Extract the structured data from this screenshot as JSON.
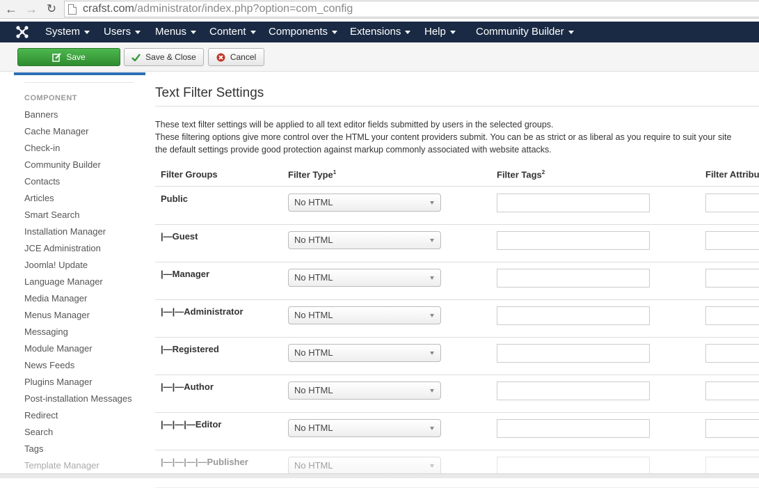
{
  "browser": {
    "url_host": "crafst.com",
    "url_path": "/administrator/index.php?option=com_config"
  },
  "topnav": {
    "logo": "joomla-icon",
    "items": [
      {
        "label": "System"
      },
      {
        "label": "Users"
      },
      {
        "label": "Menus"
      },
      {
        "label": "Content"
      },
      {
        "label": "Components"
      },
      {
        "label": "Extensions"
      },
      {
        "label": "Help"
      },
      {
        "label": "Community Builder"
      }
    ]
  },
  "toolbar": {
    "save": "Save",
    "save_close": "Save & Close",
    "cancel": "Cancel"
  },
  "sidebar": {
    "heading": "COMPONENT",
    "items": [
      "Banners",
      "Cache Manager",
      "Check-in",
      "Community Builder",
      "Contacts",
      "Articles",
      "Smart Search",
      "Installation Manager",
      "JCE Administration",
      "Joomla! Update",
      "Language Manager",
      "Media Manager",
      "Menus Manager",
      "Messaging",
      "Module Manager",
      "News Feeds",
      "Plugins Manager",
      "Post-installation Messages",
      "Redirect",
      "Search",
      "Tags",
      "Template Manager"
    ]
  },
  "main": {
    "title": "Text Filter Settings",
    "desc1": "These text filter settings will be applied to all text editor fields submitted by users in the selected groups.",
    "desc2": "These filtering options give more control over the HTML your content providers submit. You can be as strict or as liberal as you require to suit your site",
    "desc3": "the default settings provide good protection against markup commonly associated with website attacks.",
    "columns": {
      "groups": "Filter Groups",
      "type": "Filter Type",
      "type_sup": "1",
      "tags": "Filter Tags",
      "tags_sup": "2",
      "attributes": "Filter Attribu"
    },
    "rows": [
      {
        "group": "Public",
        "type": "No HTML"
      },
      {
        "group": "|—Guest",
        "type": "No HTML"
      },
      {
        "group": "|—Manager",
        "type": "No HTML"
      },
      {
        "group": "|—|—Administrator",
        "type": "No HTML"
      },
      {
        "group": "|—Registered",
        "type": "No HTML"
      },
      {
        "group": "|—|—Author",
        "type": "No HTML"
      },
      {
        "group": "|—|—|—Editor",
        "type": "No HTML"
      },
      {
        "group": "|—|—|—|—Publisher",
        "type": "No HTML"
      }
    ]
  }
}
